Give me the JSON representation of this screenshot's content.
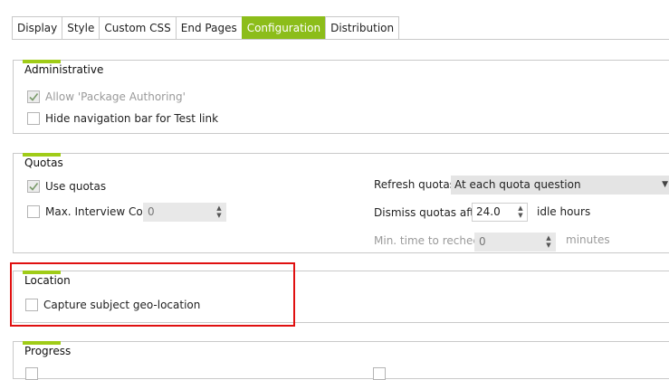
{
  "tabs": [
    {
      "label": "Display",
      "active": false
    },
    {
      "label": "Style",
      "active": false
    },
    {
      "label": "Custom CSS",
      "active": false
    },
    {
      "label": "End Pages",
      "active": false
    },
    {
      "label": "Configuration",
      "active": true
    },
    {
      "label": "Distribution",
      "active": false
    }
  ],
  "colors": {
    "accent": "#8cbd1a",
    "highlight": "#e01010"
  },
  "administrative": {
    "title": "Administrative",
    "allow_package_authoring": {
      "label": "Allow 'Package Authoring'",
      "checked": true
    },
    "hide_navigation_bar": {
      "label": "Hide navigation bar for Test link",
      "checked": false
    }
  },
  "quotas": {
    "title": "Quotas",
    "use_quotas": {
      "label": "Use quotas",
      "checked": true
    },
    "max_interview": {
      "label": "Max. Interview Coun",
      "checked": false,
      "value": "0"
    },
    "refresh_quotas": {
      "label": "Refresh quotas",
      "selected": "At each quota question"
    },
    "dismiss_quotas": {
      "label": "Dismiss quotas after",
      "value": "24.0",
      "unit": "idle hours"
    },
    "min_time_recheck": {
      "label": "Min. time to recheck",
      "value": "0",
      "unit": "minutes"
    }
  },
  "location": {
    "title": "Location",
    "capture_geo": {
      "label": "Capture subject geo-location",
      "checked": false
    }
  },
  "progress": {
    "title": "Progress"
  }
}
